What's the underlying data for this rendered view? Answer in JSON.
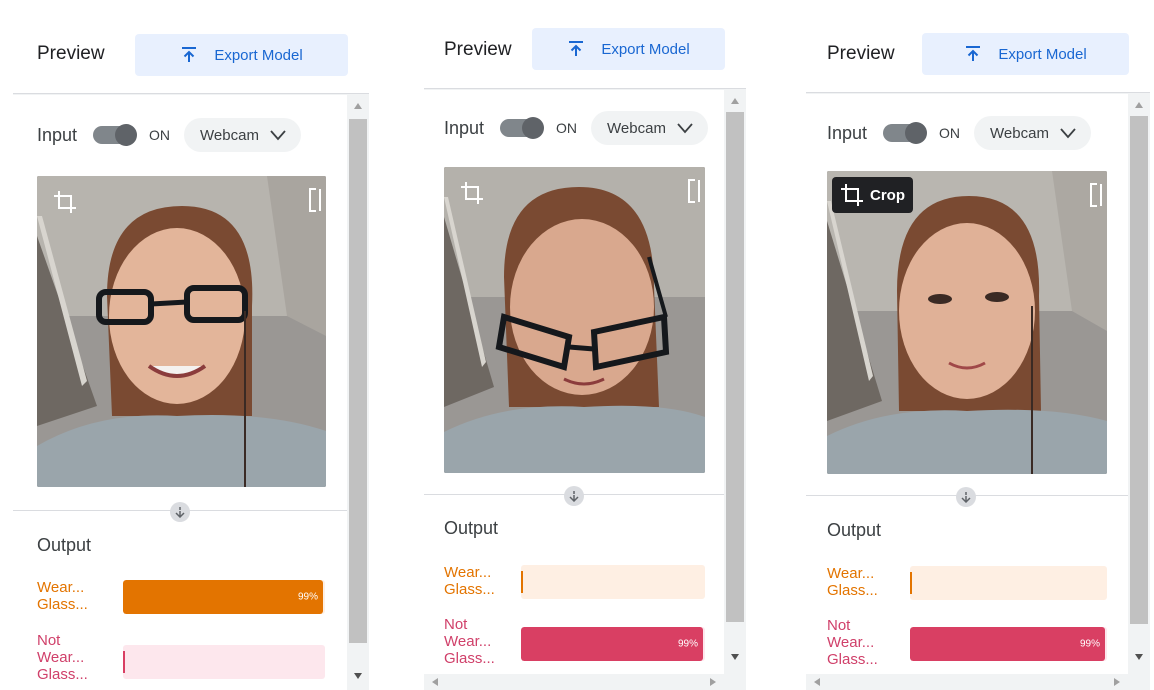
{
  "colors": {
    "accent_blue": "#1967d2",
    "export_bg": "#e8f0fe",
    "class1_color": "#e37400",
    "class1_track": "#feefe3",
    "class2_color": "#d93f63",
    "class2_label": "#d0406a",
    "class2_track": "#fde7ed"
  },
  "panels": [
    {
      "header": {
        "title": "Preview",
        "export_label": "Export Model",
        "export_icon": "upload-icon"
      },
      "input": {
        "label": "Input",
        "toggle_text": "ON",
        "source": "Webcam"
      },
      "webcam": {
        "crop_icon": "crop-icon",
        "crop_label": "",
        "fullscreen_icon": "fullscreen-icon"
      },
      "output": {
        "label": "Output",
        "classes": [
          {
            "label_lines": [
              "Wear...",
              "Glass..."
            ],
            "confidence": 0.99,
            "percent_text": "99%"
          },
          {
            "label_lines": [
              "Not",
              "Wear...",
              "Glass..."
            ],
            "confidence": 0.0,
            "percent_text": ""
          }
        ]
      }
    },
    {
      "header": {
        "title": "Preview",
        "export_label": "Export Model",
        "export_icon": "upload-icon"
      },
      "input": {
        "label": "Input",
        "toggle_text": "ON",
        "source": "Webcam"
      },
      "webcam": {
        "crop_icon": "crop-icon",
        "crop_label": "",
        "fullscreen_icon": "fullscreen-icon"
      },
      "output": {
        "label": "Output",
        "classes": [
          {
            "label_lines": [
              "Wear...",
              "Glass..."
            ],
            "confidence": 0.0,
            "percent_text": ""
          },
          {
            "label_lines": [
              "Not",
              "Wear...",
              "Glass..."
            ],
            "confidence": 0.99,
            "percent_text": "99%"
          }
        ]
      }
    },
    {
      "header": {
        "title": "Preview",
        "export_label": "Export Model",
        "export_icon": "upload-icon"
      },
      "input": {
        "label": "Input",
        "toggle_text": "ON",
        "source": "Webcam"
      },
      "webcam": {
        "crop_icon": "crop-icon",
        "crop_label": "Crop",
        "fullscreen_icon": "fullscreen-icon"
      },
      "output": {
        "label": "Output",
        "classes": [
          {
            "label_lines": [
              "Wear...",
              "Glass..."
            ],
            "confidence": 0.0,
            "percent_text": ""
          },
          {
            "label_lines": [
              "Not",
              "Wear...",
              "Glass..."
            ],
            "confidence": 0.99,
            "percent_text": "99%"
          }
        ]
      }
    }
  ]
}
